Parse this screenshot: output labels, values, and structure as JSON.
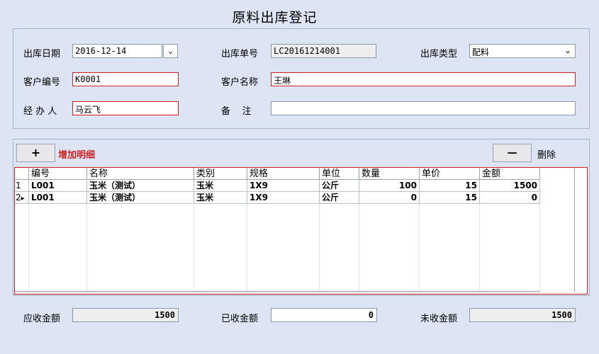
{
  "title": "原料出库登记",
  "header": {
    "date_label": "出库日期",
    "date_value": "2016-12-14",
    "order_no_label": "出库单号",
    "order_no_value": "LC20161214001",
    "type_label": "出库类型",
    "type_value": "配料",
    "customer_code_label": "客户编号",
    "customer_code_value": "K0001",
    "customer_name_label": "客户名称",
    "customer_name_value": "王琳",
    "handler_label": "经 办 人",
    "handler_value": "马云飞",
    "remark_label": "备    注",
    "remark_value": ""
  },
  "toolbar": {
    "add_button": "+",
    "add_label": "增加明细",
    "delete_button": "—",
    "delete_label": "删除"
  },
  "table": {
    "columns": [
      "编号",
      "名称",
      "类别",
      "规格",
      "单位",
      "数量",
      "单价",
      "金额"
    ],
    "rows": [
      {
        "index": "1",
        "marker": "",
        "cells": [
          "L001",
          "玉米（测试）",
          "玉米",
          "1X9",
          "公斤",
          "100",
          "15",
          "1500"
        ]
      },
      {
        "index": "2",
        "marker": "▸",
        "cells": [
          "L001",
          "玉米（测试）",
          "玉米",
          "1X9",
          "公斤",
          "0",
          "15",
          "0"
        ]
      }
    ]
  },
  "footer": {
    "receivable_label": "应收金额",
    "receivable_value": "1500",
    "received_label": "已收金额",
    "received_value": "0",
    "outstanding_label": "未收金额",
    "outstanding_value": "1500"
  },
  "colors": {
    "background": "#dde5f4",
    "required_border": "#cc2222",
    "add_label_color": "#cc2222"
  }
}
